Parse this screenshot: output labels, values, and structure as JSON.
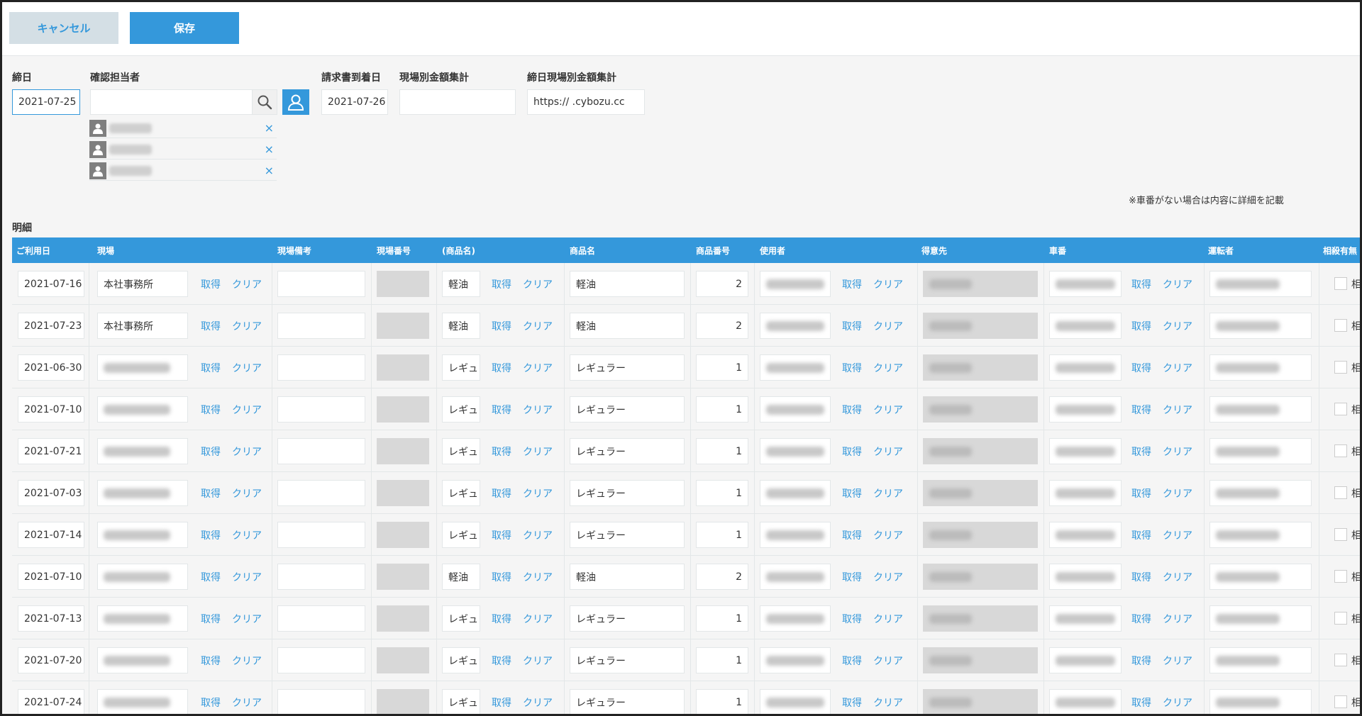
{
  "toolbar": {
    "cancel_label": "キャンセル",
    "save_label": "保存"
  },
  "form": {
    "closing_date_label": "締日",
    "closing_date_value": "2021-07-25",
    "assignee_label": "確認担当者",
    "assignee_value": "",
    "invoice_date_label": "請求書到着日",
    "invoice_date_value": "2021-07-26",
    "site_total_label": "現場別金額集計",
    "site_total_value": "",
    "closing_site_total_label": "締日現場別金額集計",
    "closing_site_total_value": "https://        .cybozu.cc",
    "assignees_count": 3,
    "remove_label": "×"
  },
  "note": "※車番がない場合は内容に詳細を記載",
  "section_label": "明細",
  "table": {
    "headers": [
      "ご利用日",
      "現場",
      "現場備考",
      "現場番号",
      "(商品名)",
      "商品名",
      "商品番号",
      "使用者",
      "得意先",
      "車番",
      "運転者",
      "相殺有無"
    ],
    "get_label": "取得",
    "clear_label": "クリア",
    "offset_label": "相",
    "rows": [
      {
        "date": "2021-07-16",
        "site": "本社事務所",
        "product_short": "軽油",
        "product": "軽油",
        "product_no": "2"
      },
      {
        "date": "2021-07-23",
        "site": "本社事務所",
        "product_short": "軽油",
        "product": "軽油",
        "product_no": "2"
      },
      {
        "date": "2021-06-30",
        "site": "",
        "product_short": "レギュ",
        "product": "レギュラー",
        "product_no": "1"
      },
      {
        "date": "2021-07-10",
        "site": "",
        "product_short": "レギュ",
        "product": "レギュラー",
        "product_no": "1"
      },
      {
        "date": "2021-07-21",
        "site": "",
        "product_short": "レギュ",
        "product": "レギュラー",
        "product_no": "1"
      },
      {
        "date": "2021-07-03",
        "site": "",
        "product_short": "レギュ",
        "product": "レギュラー",
        "product_no": "1"
      },
      {
        "date": "2021-07-14",
        "site": "",
        "product_short": "レギュ",
        "product": "レギュラー",
        "product_no": "1"
      },
      {
        "date": "2021-07-10",
        "site": "",
        "product_short": "軽油",
        "product": "軽油",
        "product_no": "2"
      },
      {
        "date": "2021-07-13",
        "site": "",
        "product_short": "レギュ",
        "product": "レギュラー",
        "product_no": "1"
      },
      {
        "date": "2021-07-20",
        "site": "",
        "product_short": "レギュ",
        "product": "レギュラー",
        "product_no": "1"
      },
      {
        "date": "2021-07-24",
        "site": "",
        "product_short": "レギュ",
        "product": "レギュラー",
        "product_no": "1"
      }
    ]
  },
  "colors": {
    "accent": "#3498db",
    "cancel_bg": "#d4dfe5",
    "disabled": "#d8d8d8"
  }
}
